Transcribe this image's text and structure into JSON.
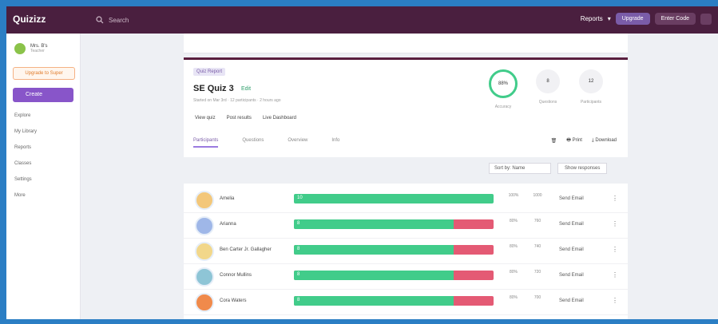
{
  "app": {
    "logo": "Quizizz",
    "search_placeholder": "Search"
  },
  "topbar": {
    "reports": "Reports",
    "upgrade": "Upgrade",
    "enter_code": "Enter Code"
  },
  "sidebar": {
    "profile_name": "Mrs. B's",
    "profile_sub": "Teacher",
    "upgrade": "Upgrade to Super",
    "create": "Create",
    "items": [
      "Explore",
      "My Library",
      "Reports",
      "Classes",
      "Settings",
      "More"
    ]
  },
  "report": {
    "tag": "Quiz Report",
    "title": "SE Quiz 3",
    "edit": "Edit",
    "meta": "Started on Mar 3rd · 12 participants · 2 hours ago",
    "links": [
      "View quiz",
      "Post results",
      "Live Dashboard"
    ],
    "stats": [
      {
        "value": "88%",
        "label": "Accuracy"
      },
      {
        "value": "8",
        "label": "Questions"
      },
      {
        "value": "12",
        "label": "Participants"
      }
    ],
    "tabs": [
      "Participants",
      "Questions",
      "Overview",
      "Info"
    ],
    "tools": [
      "Print",
      "Download"
    ]
  },
  "filters": {
    "sort": "Sort by: Name",
    "show": "Show responses"
  },
  "participants": [
    {
      "name": "Amelia",
      "correct_pct": 100,
      "count": "10",
      "acc": "100%",
      "score": "1000",
      "action": "Send Email"
    },
    {
      "name": "Arianna",
      "correct_pct": 80,
      "count": "8",
      "acc": "80%",
      "score": "760",
      "action": "Send Email"
    },
    {
      "name": "Ben Carter Jr. Gallagher",
      "correct_pct": 80,
      "count": "8",
      "acc": "80%",
      "score": "740",
      "action": "Send Email"
    },
    {
      "name": "Connor Mullins",
      "correct_pct": 80,
      "count": "8",
      "acc": "80%",
      "score": "720",
      "action": "Send Email"
    },
    {
      "name": "Cora Waters",
      "correct_pct": 80,
      "count": "8",
      "acc": "80%",
      "score": "700",
      "action": "Send Email"
    }
  ]
}
